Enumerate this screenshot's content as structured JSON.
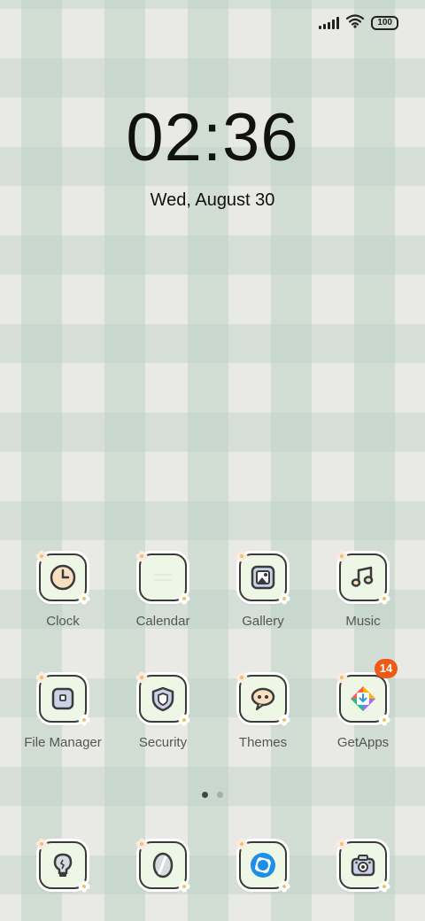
{
  "status_bar": {
    "signal_icon": "signal-bars-icon",
    "wifi_icon": "wifi-icon",
    "battery_level": "100"
  },
  "lock_clock": {
    "time": "02:36",
    "date": "Wed, August 30"
  },
  "home_grid": [
    {
      "label": "Clock",
      "icon": "clock-icon"
    },
    {
      "label": "Calendar",
      "icon": "calendar-icon"
    },
    {
      "label": "Gallery",
      "icon": "gallery-icon"
    },
    {
      "label": "Music",
      "icon": "music-icon"
    },
    {
      "label": "File Manager",
      "icon": "folder-icon"
    },
    {
      "label": "Security",
      "icon": "shield-icon"
    },
    {
      "label": "Themes",
      "icon": "chat-bubble-icon"
    },
    {
      "label": "GetApps",
      "icon": "getapps-icon",
      "badge": "14"
    }
  ],
  "page_indicator": {
    "pages": 2,
    "current": 1
  },
  "dock": [
    {
      "icon": "lightbulb-icon"
    },
    {
      "icon": "feather-icon"
    },
    {
      "icon": "browser-icon"
    },
    {
      "icon": "camera-icon"
    }
  ],
  "colors": {
    "badge": "#ef5a17",
    "tile": "#eef6e6",
    "outline": "#3a3a3a"
  }
}
